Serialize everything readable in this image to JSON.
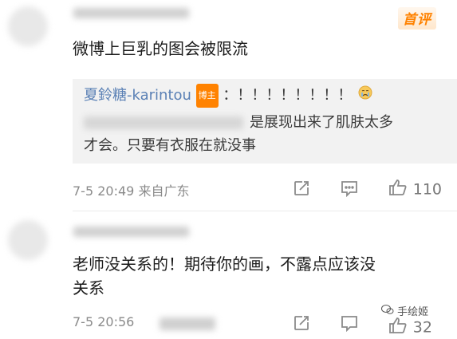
{
  "badge": "首评",
  "comment1": {
    "text": "微博上巨乳的图会被限流",
    "reply": {
      "name": "夏鈴糖-karintou",
      "tag": "博主",
      "exclaim": "：！！！！！！！！",
      "emoji": "crying-face-icon",
      "line1": "是展现出来了肌肤太多",
      "line2": "才会。只要有衣服在就没事"
    },
    "date": "7-5",
    "time": "20:49",
    "location": "来自广东",
    "like_count": "110"
  },
  "comment2": {
    "line1": "老师没关系的！期待你的画，不露点应该没",
    "line2": "关系",
    "date": "7-5",
    "time": "20:56",
    "like_count": "32"
  },
  "watermark": "手绘姬",
  "colors": {
    "accent": "#ff8200",
    "link": "#5a80b5",
    "meta": "#8a8a8a",
    "reply_bg": "#f2f2f2"
  }
}
